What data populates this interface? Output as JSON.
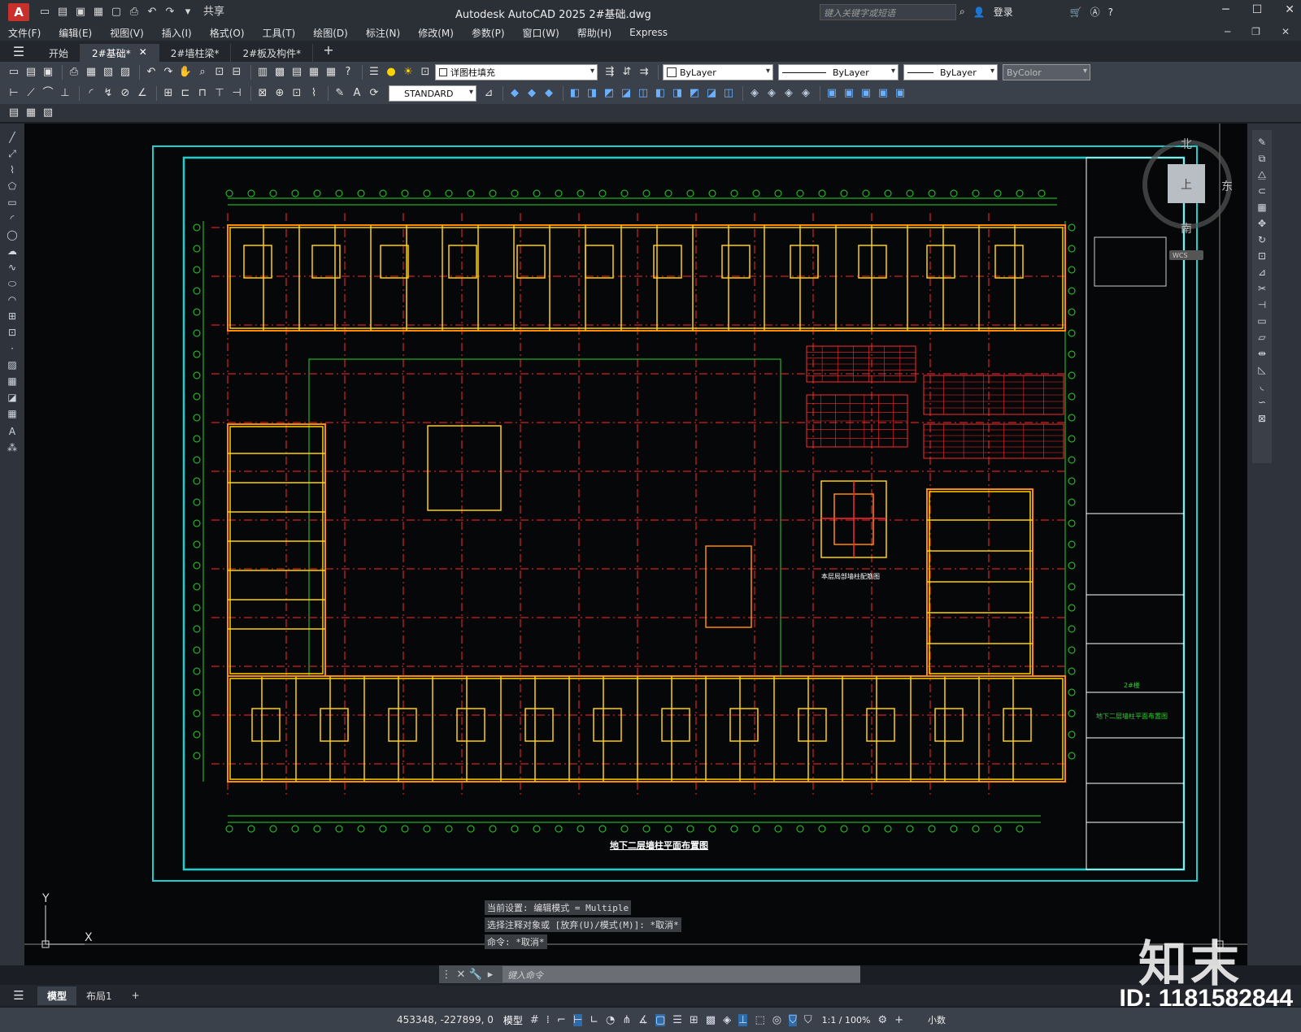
{
  "titlebar": {
    "app_letter": "A",
    "share": "共享",
    "title": "Autodesk AutoCAD 2025    2#基础.dwg",
    "search_placeholder": "键入关键字或短语",
    "login": "登录"
  },
  "menu": [
    "文件(F)",
    "编辑(E)",
    "视图(V)",
    "插入(I)",
    "格式(O)",
    "工具(T)",
    "绘图(D)",
    "标注(N)",
    "修改(M)",
    "参数(P)",
    "窗口(W)",
    "帮助(H)",
    "Express"
  ],
  "tabs": {
    "start": "开始",
    "items": [
      {
        "label": "2#基础*",
        "close": "✕"
      },
      {
        "label": "2#墙柱梁*",
        "close": ""
      },
      {
        "label": "2#板及构件*",
        "close": ""
      }
    ],
    "add": "+"
  },
  "toolbar": {
    "layer_name": "详图柱填充",
    "color": "ByLayer",
    "linetype": "ByLayer",
    "lineweight": "ByLayer",
    "plotstyle": "ByColor",
    "textstyle": "STANDARD"
  },
  "viewcube": {
    "north": "北",
    "south": "南",
    "east": "东",
    "top": "上",
    "wcs": "WCS"
  },
  "ucs": {
    "x": "X",
    "y": "Y"
  },
  "drawing": {
    "plan_title": "地下二层墙柱平面布置图",
    "detail_title": "本层局部墙柱配筋图",
    "titleblock_project": "2#楼",
    "titleblock_drawing": "地下二层墙柱平面布置图"
  },
  "command_history": [
    "当前设置: 编辑模式 = Multiple",
    "选择注释对象或 [放弃(U)/模式(M)]: *取消*",
    "命令: *取消*"
  ],
  "command_placeholder": "键入命令",
  "layout_tabs": {
    "model": "模型",
    "layout1": "布局1",
    "add": "+"
  },
  "status": {
    "coords": "453348, -227899, 0",
    "model": "模型",
    "scale": "1:1 / 100%",
    "units": "小数"
  },
  "watermark": {
    "logo": "知末",
    "id": "ID: 1181582844"
  },
  "colors": {
    "wall_yellow": "#ffd200",
    "wall_orange": "#ff8a00",
    "grid_red": "#ff2a2a",
    "dim_green": "#28d428",
    "frame_cyan": "#19d0d0",
    "canvas_bg": "#060709"
  }
}
